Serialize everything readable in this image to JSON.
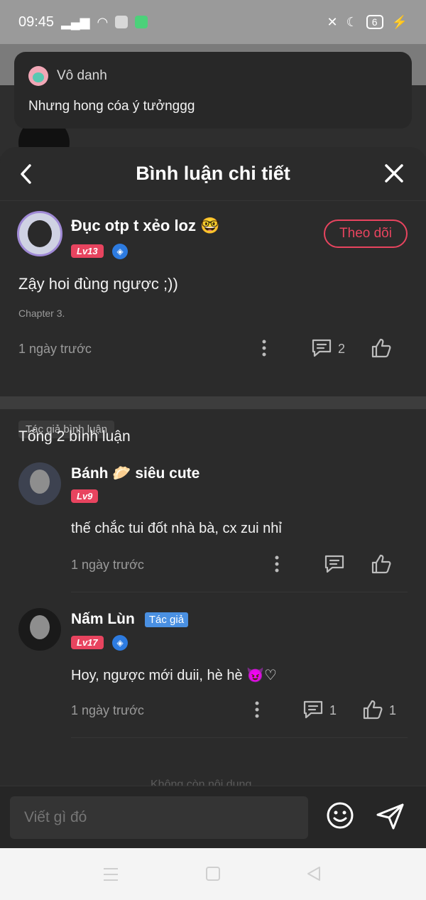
{
  "status_bar": {
    "time": "09:45",
    "battery": "6"
  },
  "notification": {
    "sender": "Vô danh",
    "message": "Nhưng hong cóa ý tưởnggg"
  },
  "sheet": {
    "title": "Bình luận chi tiết"
  },
  "main_comment": {
    "author": "Đục otp t xẻo loz 🤓",
    "level": "Lv13",
    "follow_label": "Theo dõi",
    "text": "Zậy hoi đùng ngược ;))",
    "chapter": "Chapter 3.",
    "time": "1 ngày trước",
    "reply_count": "2",
    "author_tag": "Tác giả bình luận"
  },
  "replies_header": "Tổng 2 bình luận",
  "replies": [
    {
      "author": "Bánh 🥟 siêu cute",
      "level": "Lv9",
      "text": "thế chắc tui đốt nhà bà, cx zui nhỉ",
      "time": "1 ngày trước"
    },
    {
      "author": "Nấm Lùn",
      "author_pill": "Tác giả",
      "level": "Lv17",
      "text": "Hoy, ngược mới duii, hè hè 😈♡",
      "time": "1 ngày trước",
      "reply_count": "1",
      "like_count": "1"
    }
  ],
  "faded_footer": "Không còn nội dung",
  "input": {
    "placeholder": "Viết gì đó"
  },
  "colors": {
    "accent": "#e8445f",
    "author_blue": "#4a90e2",
    "background": "#2b2b2b"
  }
}
